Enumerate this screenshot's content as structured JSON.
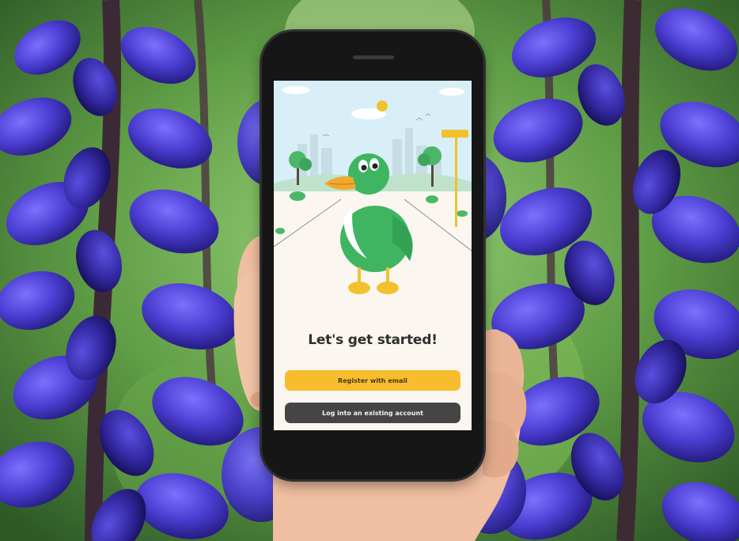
{
  "screen": {
    "headline": "Let's get started!",
    "register_label": "Register with email",
    "login_label": "Log into an existing account"
  },
  "colors": {
    "accent_yellow": "#f7bd2e",
    "dark_button": "#454545",
    "duck_green": "#3fb562",
    "flower_purple": "#4b3fc9"
  }
}
